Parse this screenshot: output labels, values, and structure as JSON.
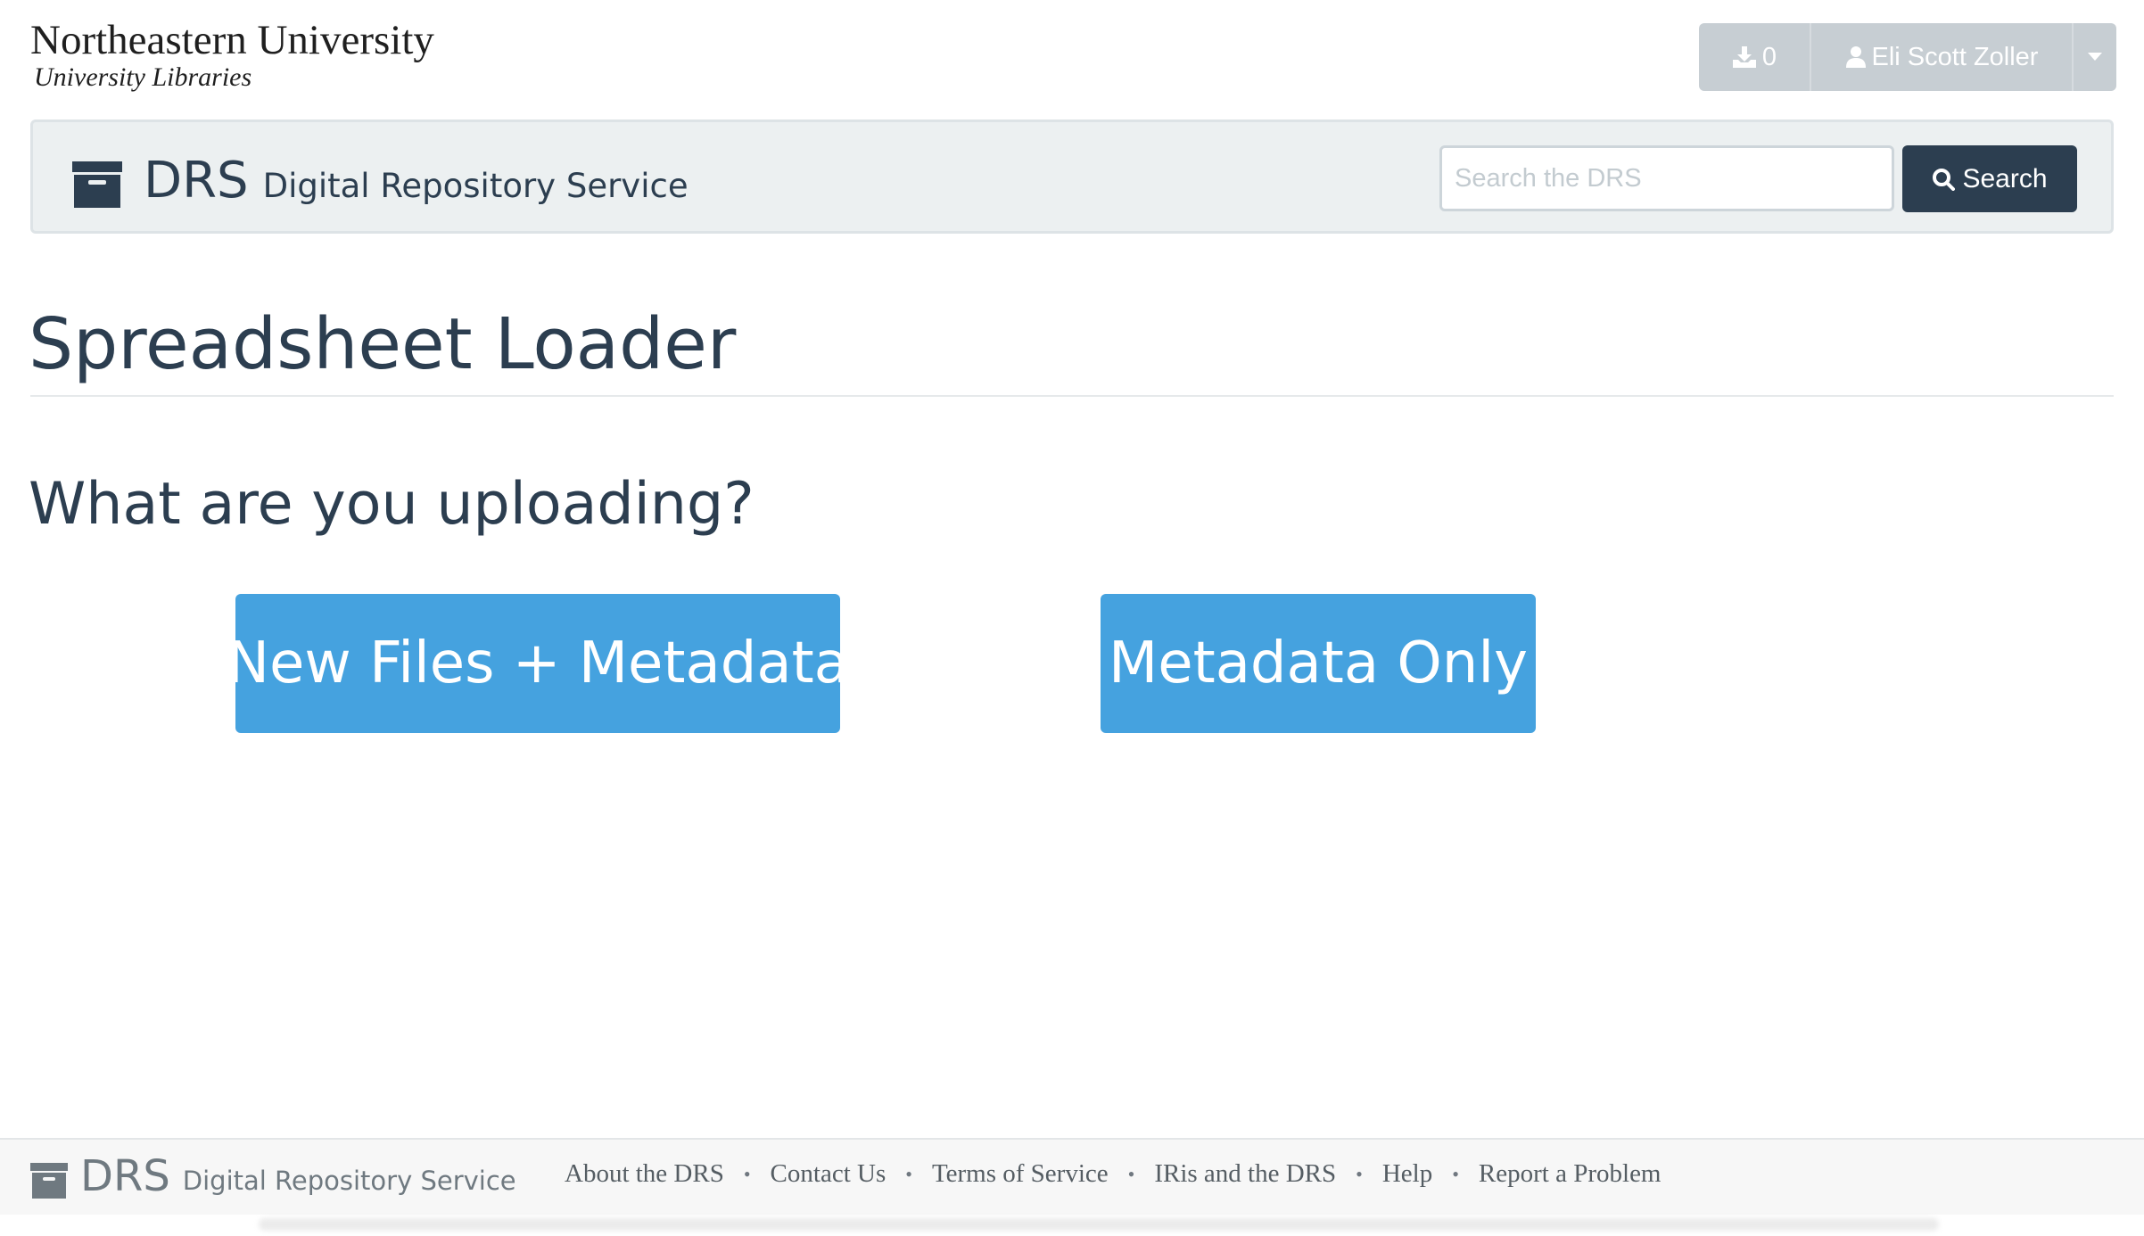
{
  "header": {
    "university_name": "Northeastern University",
    "library_name": "University Libraries",
    "download_count": "0",
    "user_name": "Eli Scott Zoller"
  },
  "band": {
    "drs": "DRS",
    "subtitle": "Digital Repository Service",
    "search_placeholder": "Search the DRS",
    "search_label": "Search"
  },
  "main": {
    "title": "Spreadsheet Loader",
    "question": "What are you uploading?",
    "choices": [
      "New Files + Metadata",
      "Metadata Only"
    ]
  },
  "footer": {
    "drs": "DRS",
    "subtitle": "Digital Repository Service",
    "links": [
      "About the DRS",
      "Contact Us",
      "Terms of Service",
      "IRis and the DRS",
      "Help",
      "Report a Problem"
    ]
  },
  "colors": {
    "navy": "#2c3e50",
    "accent_blue": "#45a2df",
    "band_bg": "#ecf0f1",
    "user_bar": "#c7ced3"
  }
}
